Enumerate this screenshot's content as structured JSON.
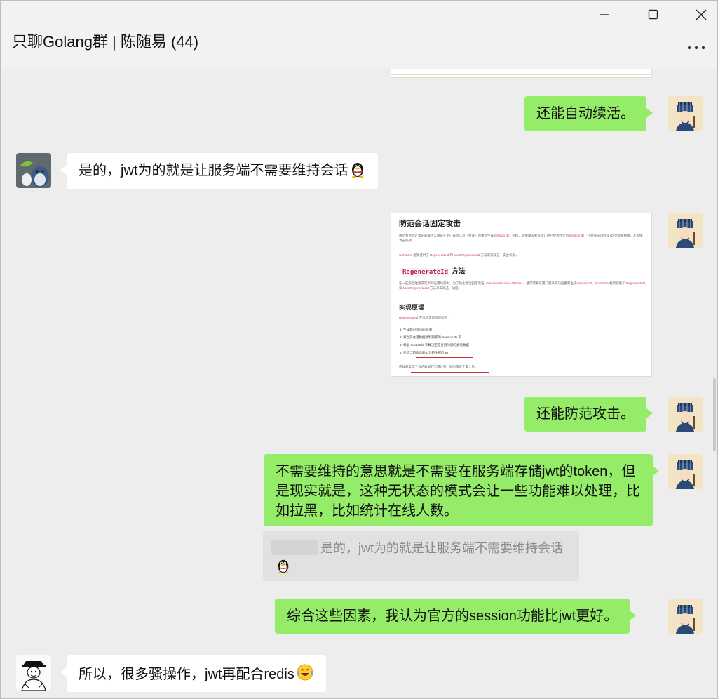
{
  "window": {
    "title": "只聊Golang群 | 陈随易 (44)",
    "controls": [
      "minimize-icon",
      "maximize-icon",
      "close-icon"
    ],
    "more_icon": "more-dots-icon"
  },
  "messages": [
    {
      "sender": "me",
      "text": "还能自动续活。"
    },
    {
      "sender": "other",
      "text": "是的，jwt为的就是让服务端不需要维持会话",
      "emoji": "qq-penguin-icon"
    },
    {
      "sender": "me",
      "type": "image"
    },
    {
      "sender": "me",
      "text": "还能防范攻击。"
    },
    {
      "sender": "me",
      "text": "不需要维持的意思就是不需要在服务端存储jwt的token，但是现实就是，这种无状态的模式会让一些功能难以处理，比如拉黑，比如统计在线人数。"
    },
    {
      "sender": "me",
      "type": "quote",
      "text": "是的，jwt为的就是让服务端不需要维持会话",
      "emoji": "qq-penguin-icon"
    },
    {
      "sender": "me",
      "text": "综合这些因素，我认为官方的session功能比jwt更好。"
    },
    {
      "sender": "other",
      "text": "所以，很多骚操作，jwt再配合redis",
      "emoji": "laughing-tears-icon"
    }
  ],
  "screenshot": {
    "h1": "防范会话固定攻击",
    "p1a": "防范会话固定攻击的最佳实践是在用户成功认证（登录）后重新生成",
    "p1code": "Session ID",
    "p1b": "。这样，即便攻击者设法让用户使用特定的",
    "p1code2": "Session ID",
    "p1c": "，在登录成功后该 ID 也会被替换，从而使攻击失效。",
    "p2code1": "GoFrame",
    "p2a": " 框架提供了 ",
    "p2code2": "RegenerateId",
    "p2b": " 和 ",
    "p2code3": "MustRegenerateId",
    "p2c": " 方法来实现这一安全机制。",
    "h2code": "RegenerateId",
    "h2text": "方法",
    "p3a": "在一些安全性要求较高的应用场景中，为了防止会话固定攻击（",
    "p3code": "Session Fixation Attacks",
    "p3b": "），通常需要在用户登录成功后重新生成",
    "p3code2": "Session ID",
    "p3c": "。",
    "p3code3": "GoFrame",
    "p3d": " 框架提供了 ",
    "p3code4": "RegenerateId",
    "p3e": " 和 ",
    "p3code5": "MustRegenerateId",
    "p3f": " 方法来实现这一功能。",
    "h3": "实现原理",
    "p4code": "RegenerateId",
    "p4a": " 方法的实现原理如下：",
    "steps": [
      "生成新的 Session ID",
      "将当前会话数据复制到新的 Session ID 下",
      "根据 deleteOld 参数决定是否删除旧的会话数据",
      "更新当前会话的ID为新生成的 ID"
    ],
    "footer": "这样就实现了会话数据的无缝迁移，同时保证了安全性。"
  }
}
